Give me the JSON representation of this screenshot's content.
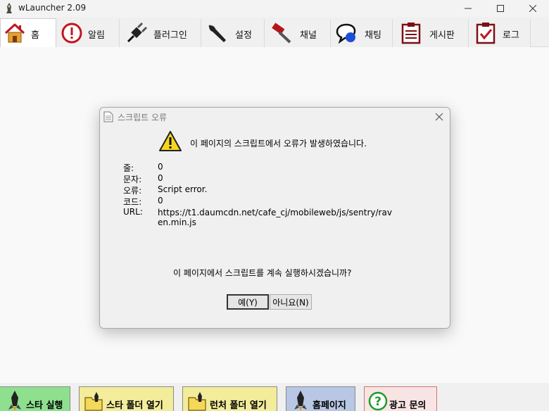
{
  "window": {
    "title": "wLauncher 2.09"
  },
  "tabs": [
    {
      "label": "홈",
      "icon": "home-icon",
      "active": true
    },
    {
      "label": "알림",
      "icon": "alert-icon",
      "active": false
    },
    {
      "label": "플러그인",
      "icon": "plug-icon",
      "active": false
    },
    {
      "label": "설정",
      "icon": "wrench-icon",
      "active": false
    },
    {
      "label": "채널",
      "icon": "hammer-icon",
      "active": false
    },
    {
      "label": "채팅",
      "icon": "chat-icon",
      "active": false
    },
    {
      "label": "게시판",
      "icon": "board-icon",
      "active": false
    },
    {
      "label": "로그",
      "icon": "log-icon",
      "active": false
    }
  ],
  "dialog": {
    "title": "스크립트 오류",
    "message": "이 페이지의 스크립트에서 오류가 발생하였습니다.",
    "fields": [
      {
        "label": "줄:",
        "value": "0"
      },
      {
        "label": "문자:",
        "value": "0"
      },
      {
        "label": "오류:",
        "value": "Script error."
      },
      {
        "label": "코드:",
        "value": "0"
      },
      {
        "label": "URL:",
        "value": "https://t1.daumcdn.net/cafe_cj/mobileweb/js/sentry/raven.min.js"
      }
    ],
    "question": "이 페이지에서 스크립트를 계속 실행하시겠습니까?",
    "yes_label": "예(Y)",
    "no_label": "아니요(N)"
  },
  "bottom_buttons": [
    {
      "label": "스타 실행",
      "color": "#8ee08e"
    },
    {
      "label": "스타 폴더 열기",
      "color": "#f2ec9b"
    },
    {
      "label": "런처 폴더 열기",
      "color": "#f2ec9b"
    },
    {
      "label": "홈페이지",
      "color": "#b8c8e4"
    },
    {
      "label": "광고 문의",
      "color": "#f9e4e4"
    }
  ],
  "colors": {
    "accent_red": "#c0161f",
    "content_bg": "#f9f9f9"
  }
}
